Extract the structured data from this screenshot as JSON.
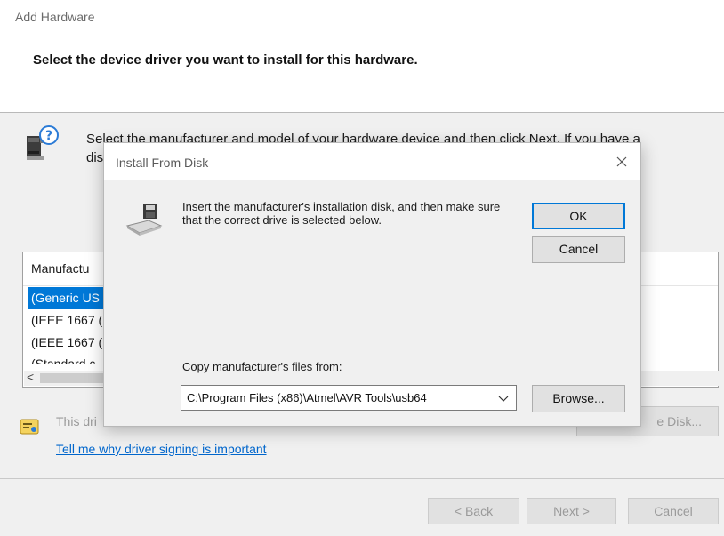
{
  "wizard": {
    "title": "Add Hardware",
    "heading": "Select the device driver you want to install for this hardware.",
    "instruction_line1": "Select the manufacturer and model of your hardware device and then click Next. If you have a",
    "instruction_line2": "dis",
    "list_header": "Manufactu",
    "list_items": [
      "(Generic US",
      "(IEEE 1667 (",
      "(IEEE 1667 (",
      "(Standard c"
    ],
    "scroll_left": "<",
    "signing_text": "This dri",
    "have_disk_label": "e Disk...",
    "link_text": "Tell me why driver signing is important",
    "back_label": "< Back",
    "next_label": "Next >",
    "cancel_label": "Cancel"
  },
  "dialog": {
    "title": "Install From Disk",
    "close_glyph": "×",
    "message": "Insert the manufacturer's installation disk, and then make sure that the correct drive is selected below.",
    "ok_label": "OK",
    "cancel_label": "Cancel",
    "copy_label": "Copy manufacturer's files from:",
    "path_value": "C:\\Program Files (x86)\\Atmel\\AVR Tools\\usb64",
    "browse_label": "Browse..."
  },
  "colors": {
    "selection": "#0078d7",
    "link": "#0066cc",
    "default_button_border": "#0078d7"
  },
  "icons": [
    "hardware-help-icon",
    "driver-signing-icon",
    "floppy-disk-icon",
    "close-icon",
    "chevron-down-icon"
  ]
}
